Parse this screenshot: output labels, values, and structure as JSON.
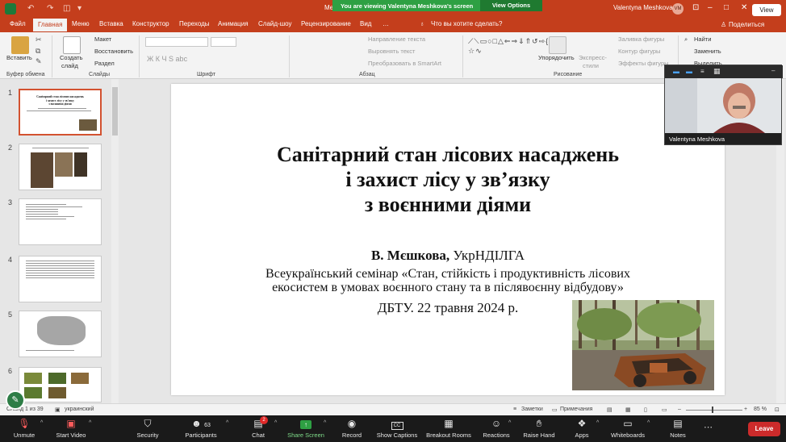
{
  "titlebar": {
    "doc_title_partial": "Me",
    "user_name": "Valentyna Meshkova",
    "avatar_initials": "VM"
  },
  "share_banner": {
    "message": "You are viewing Valentyna Meshkova's screen",
    "view_options": "View Options",
    "view_button": "View"
  },
  "tabs": [
    "Файл",
    "Главная",
    "Меню",
    "Вставка",
    "Конструктор",
    "Переходы",
    "Анимация",
    "Слайд-шоу",
    "Рецензирование",
    "Вид"
  ],
  "active_tab": "Главная",
  "tell_me": "Что вы хотите сделать?",
  "share": "Поделиться",
  "ribbon": {
    "paste": "Вставить",
    "clipboard": "Буфер обмена",
    "new_slide_1": "Создать",
    "new_slide_2": "слайд",
    "layout": "Макет",
    "reset": "Восстановить",
    "section": "Раздел",
    "slides": "Слайды",
    "font_group": "Шрифт",
    "font_buttons": "Ж  К  Ч  S  abc",
    "text_direction": "Направление текста",
    "align_text": "Выровнять текст",
    "smartart": "Преобразовать в SmartArt",
    "paragraph": "Абзац",
    "arrange_1": "Упорядочить",
    "quick_styles_1": "Экспресс-",
    "quick_styles_2": "стили",
    "shape_fill": "Заливка фигуры",
    "shape_outline": "Контур фигуры",
    "shape_effects": "Эффекты фигуры",
    "drawing": "Рисование",
    "find": "Найти",
    "replace": "Заменить",
    "select": "Выделить"
  },
  "thumbnails": [
    "1",
    "2",
    "3",
    "4",
    "5",
    "6"
  ],
  "slide": {
    "title_line1": "Санітарний стан лісових насаджень",
    "title_line2": "і захист лісу у зв’язку",
    "title_line3": "з воєнними діями",
    "author_name": "В. Мєшкова,",
    "author_org": "УкрНДІЛГА",
    "seminar_line1": "Всеукраїнський семінар «Стан, стійкість і продуктивність лісових",
    "seminar_line2": "екосистем в умовах воєнного стану та в післявоєнну відбудову»",
    "date": "ДБТУ. 22 травня 2024 р."
  },
  "video": {
    "name": "Valentyna Meshkova"
  },
  "statusbar": {
    "slide_count": "Слайд 1 из 39",
    "language": "украинский",
    "notes": "Заметки",
    "comments": "Примечания",
    "zoom": "85 %"
  },
  "zoombar": {
    "unmute": "Unmute",
    "start_video": "Start Video",
    "security": "Security",
    "participants": "Participants",
    "participants_count": "63",
    "chat": "Chat",
    "chat_badge": "2",
    "share_screen": "Share Screen",
    "record": "Record",
    "show_captions": "Show Captions",
    "breakout_rooms": "Breakout Rooms",
    "reactions": "Reactions",
    "raise_hand": "Raise Hand",
    "apps": "Apps",
    "whiteboards": "Whiteboards",
    "notes": "Notes",
    "leave": "Leave"
  }
}
